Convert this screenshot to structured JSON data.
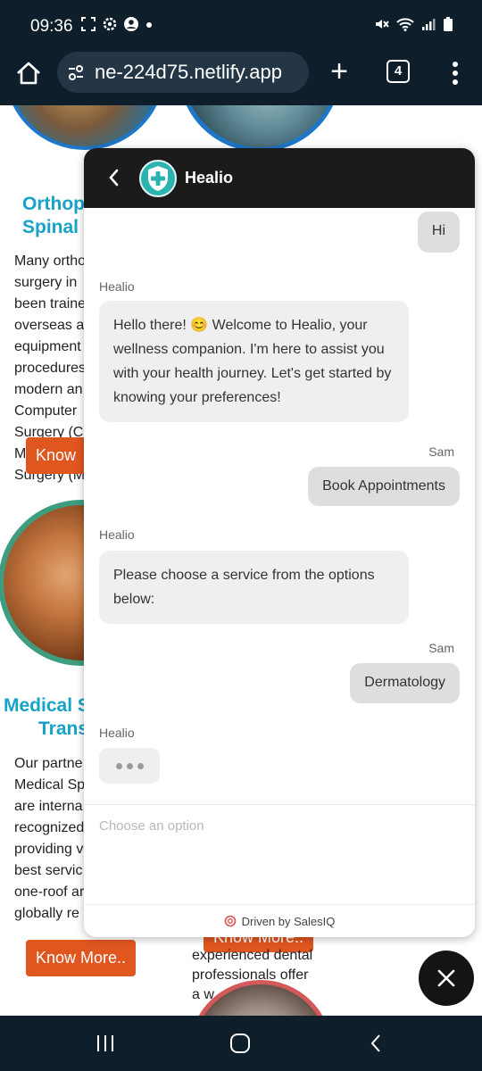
{
  "status_bar": {
    "time": "09:36"
  },
  "browser": {
    "url": "ne-224d75.netlify.app",
    "tab_count": "4"
  },
  "site": {
    "section1": {
      "heading_line1": "Orthopa",
      "heading_line2": "Spinal S",
      "paragraph": "Many ortho\nsurgery in\nbeen traine\noverseas a\nequipment\nprocedures\nmodern an\nComputer\nSurgery (C\nM\nSurgery (M",
      "button": "Know"
    },
    "section2": {
      "heading_line1": "Medical S",
      "heading_line2": "Trans",
      "paragraph": "Our partne\nMedical Sp\nare interna\nrecognized\nproviding v\nbest servic\none-roof ar\nglobally re",
      "button": "Know More.."
    },
    "section3": {
      "button": "Know More..",
      "text": "experienced dental\nprofessionals offer\na w"
    }
  },
  "chat": {
    "title": "Healio",
    "messages": [
      {
        "from": "user",
        "text": "Hi"
      },
      {
        "from": "bot",
        "sender": "Healio",
        "text_before": "Hello there! ",
        "emoji": "😊",
        "text_after": " Welcome to Healio, your wellness companion. I'm here to assist you with your health journey. Let's get started by knowing your preferences!"
      },
      {
        "from": "user",
        "sender": "Sam",
        "text": "Book Appointments"
      },
      {
        "from": "bot",
        "sender": "Healio",
        "text": "Please choose a service from the options below:"
      },
      {
        "from": "user",
        "sender": "Sam",
        "text": "Dermatology"
      },
      {
        "from": "bot",
        "sender": "Healio",
        "typing": true
      }
    ],
    "input_placeholder": "Choose an option",
    "footer": "Driven by SalesIQ",
    "colors": {
      "header_bg": "#1b1b1b",
      "avatar": "#2bb3b1",
      "user_bubble": "#dedede",
      "bot_bubble": "#efefef"
    }
  },
  "colors": {
    "site_heading": "#17a2c7",
    "site_button": "#e0561f",
    "system_bars": "#0e1f2b"
  }
}
